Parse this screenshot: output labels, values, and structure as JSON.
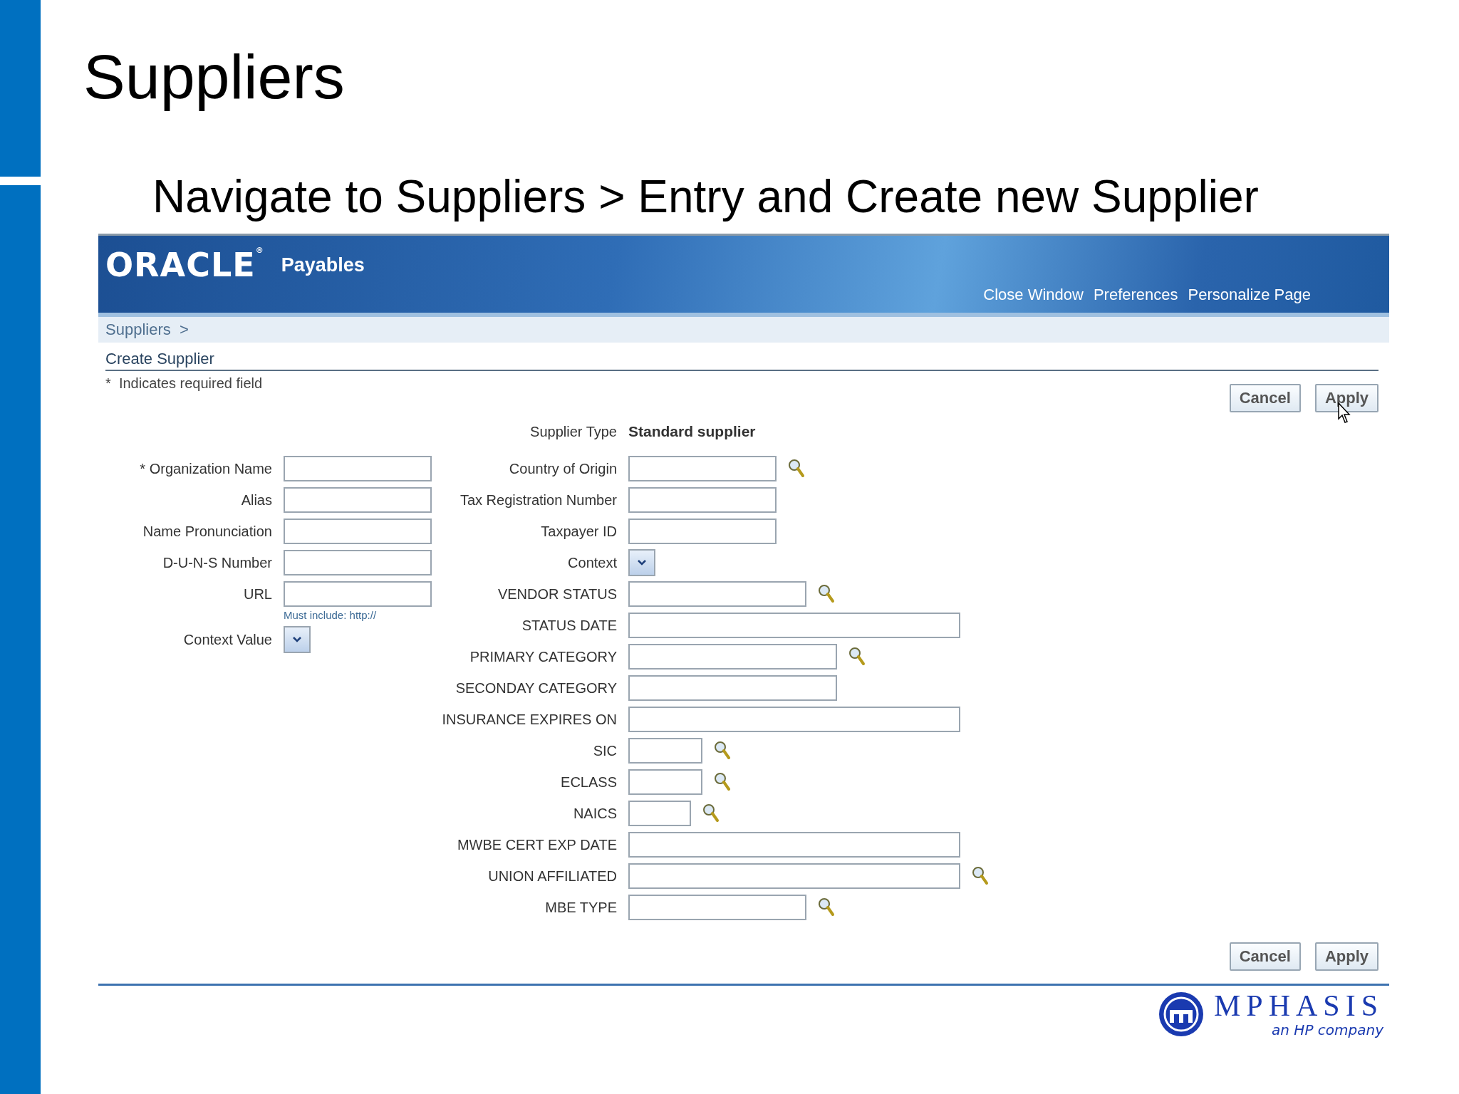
{
  "slide": {
    "title": "Suppliers",
    "subtitle": "Navigate to Suppliers > Entry and Create new Supplier"
  },
  "app": {
    "logo": "ORACLE",
    "logo_mark": "®",
    "product": "Payables",
    "global_links": [
      "Close Window",
      "Preferences",
      "Personalize Page"
    ],
    "breadcrumb": "Suppliers  >",
    "page_title": "Create Supplier",
    "required_note": "*  Indicates required field",
    "top_buttons": [
      {
        "label": "Cancel",
        "hovered": false
      },
      {
        "label": "Apply",
        "hovered": true
      }
    ],
    "supplier_type": {
      "label": "Supplier Type",
      "value": "Standard supplier"
    },
    "left_fields": [
      {
        "label": "* Organization Name",
        "kind": "text"
      },
      {
        "label": "Alias",
        "kind": "text"
      },
      {
        "label": "Name Pronunciation",
        "kind": "text"
      },
      {
        "label": "D-U-N-S Number",
        "kind": "text"
      },
      {
        "label": "URL",
        "kind": "text",
        "hint": "Must include: http://"
      },
      {
        "label": "Context Value",
        "kind": "select"
      }
    ],
    "right_fields": [
      {
        "label": "Country of Origin",
        "kind": "lov"
      },
      {
        "label": "Tax Registration Number",
        "kind": "text"
      },
      {
        "label": "Taxpayer ID",
        "kind": "text"
      },
      {
        "label": "Context",
        "kind": "select"
      },
      {
        "label": "VENDOR STATUS",
        "kind": "lov"
      },
      {
        "label": "STATUS DATE",
        "kind": "text"
      },
      {
        "label": "PRIMARY CATEGORY",
        "kind": "lov"
      },
      {
        "label": "SECONDAY CATEGORY",
        "kind": "text"
      },
      {
        "label": "INSURANCE EXPIRES ON",
        "kind": "text"
      },
      {
        "label": "SIC",
        "kind": "lov"
      },
      {
        "label": "ECLASS",
        "kind": "lov"
      },
      {
        "label": "NAICS",
        "kind": "lov"
      },
      {
        "label": "MWBE CERT EXP DATE",
        "kind": "text"
      },
      {
        "label": "UNION AFFILIATED",
        "kind": "lov"
      },
      {
        "label": "MBE TYPE",
        "kind": "lov"
      }
    ],
    "bottom_buttons": [
      {
        "label": "Cancel",
        "hovered": false
      },
      {
        "label": "Apply",
        "hovered": false
      }
    ]
  },
  "footer": {
    "brand": "MPHASIS",
    "tagline": "an HP company"
  }
}
